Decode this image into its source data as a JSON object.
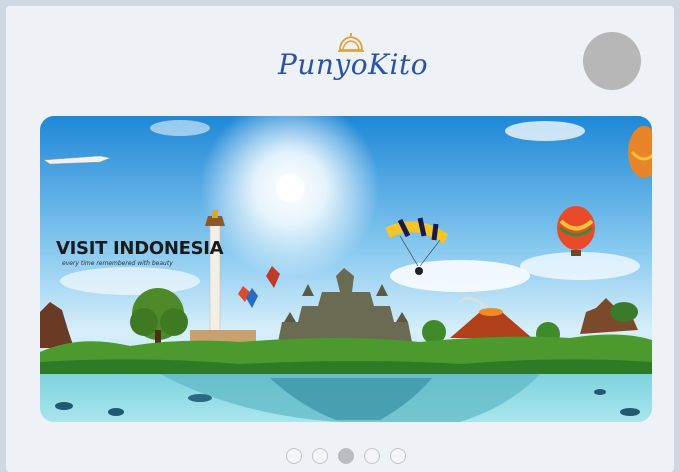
{
  "header": {
    "logo_text": "PunyoKito",
    "logo_brand_color": "#2a53a8",
    "avatar_color": "#b7b7b7"
  },
  "banner": {
    "title": "VISIT INDONESIA",
    "subtitle": "every time remembered with beauty"
  },
  "carousel": {
    "dots": [
      {
        "active": false
      },
      {
        "active": false
      },
      {
        "active": true
      },
      {
        "active": false
      },
      {
        "active": false
      }
    ],
    "active_index": 2
  }
}
